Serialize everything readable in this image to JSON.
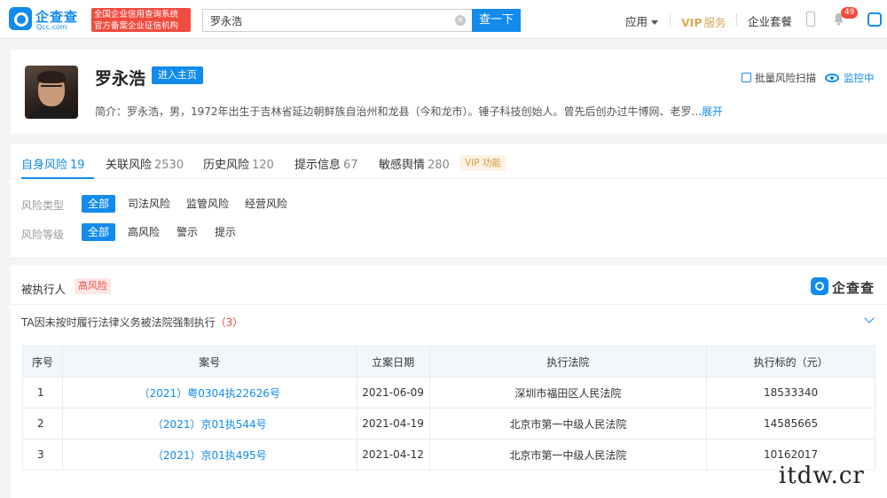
{
  "header": {
    "logo_cn": "企查查",
    "logo_en": "Qcc.com",
    "slogan_line1": "全国企业信用查询系统",
    "slogan_line2": "官方备案企业征信机构",
    "search_value": "罗永浩",
    "search_button": "查一下",
    "nav_apps": "应用",
    "nav_vip": "VIP",
    "nav_vip_service": "服务",
    "nav_plan": "企业套餐",
    "notification_count": "49"
  },
  "profile": {
    "name": "罗永浩",
    "enter_homepage": "进入主页",
    "bio": "简介：罗永浩，男，1972年出生于吉林省延边朝鲜族自治州和龙县（今和龙市）。锤子科技创始人。曾先后创办过牛博网、老罗...",
    "bio_expand": "展开",
    "batch_scan": "批量风险扫描",
    "monitoring": "监控中"
  },
  "risk": {
    "tabs": [
      {
        "label": "自身风险",
        "count": "19"
      },
      {
        "label": "关联风险",
        "count": "2530"
      },
      {
        "label": "历史风险",
        "count": "120"
      },
      {
        "label": "提示信息",
        "count": "67"
      },
      {
        "label": "敏感舆情",
        "count": "280"
      }
    ],
    "vip_tag": "VIP 功能",
    "type_label": "风险类型",
    "type_options": [
      "全部",
      "司法风险",
      "监管风险",
      "经营风险"
    ],
    "level_label": "风险等级",
    "level_options": [
      "全部",
      "高风险",
      "警示",
      "提示"
    ]
  },
  "executed": {
    "title": "被执行人",
    "risk_tag": "高风险",
    "watermark_logo": "企查查",
    "subtitle": "TA因未按时履行法律义务被法院强制执行",
    "subtitle_count": "（3）",
    "columns": [
      "序号",
      "案号",
      "立案日期",
      "执行法院",
      "执行标的（元）"
    ],
    "rows": [
      {
        "idx": "1",
        "case_no": "（2021）粤0304执22626号",
        "date": "2021-06-09",
        "court": "深圳市福田区人民法院",
        "amount": "18533340"
      },
      {
        "idx": "2",
        "case_no": "（2021）京01执544号",
        "date": "2021-04-19",
        "court": "北京市第一中级人民法院",
        "amount": "14585665"
      },
      {
        "idx": "3",
        "case_no": "（2021）京01执495号",
        "date": "2021-04-12",
        "court": "北京市第一中级人民法院",
        "amount": "10162017"
      }
    ]
  },
  "site_watermark": "itdw.cr",
  "colors": {
    "brand": "#128bed",
    "danger": "#f04c3f",
    "vip": "#d49a43"
  }
}
